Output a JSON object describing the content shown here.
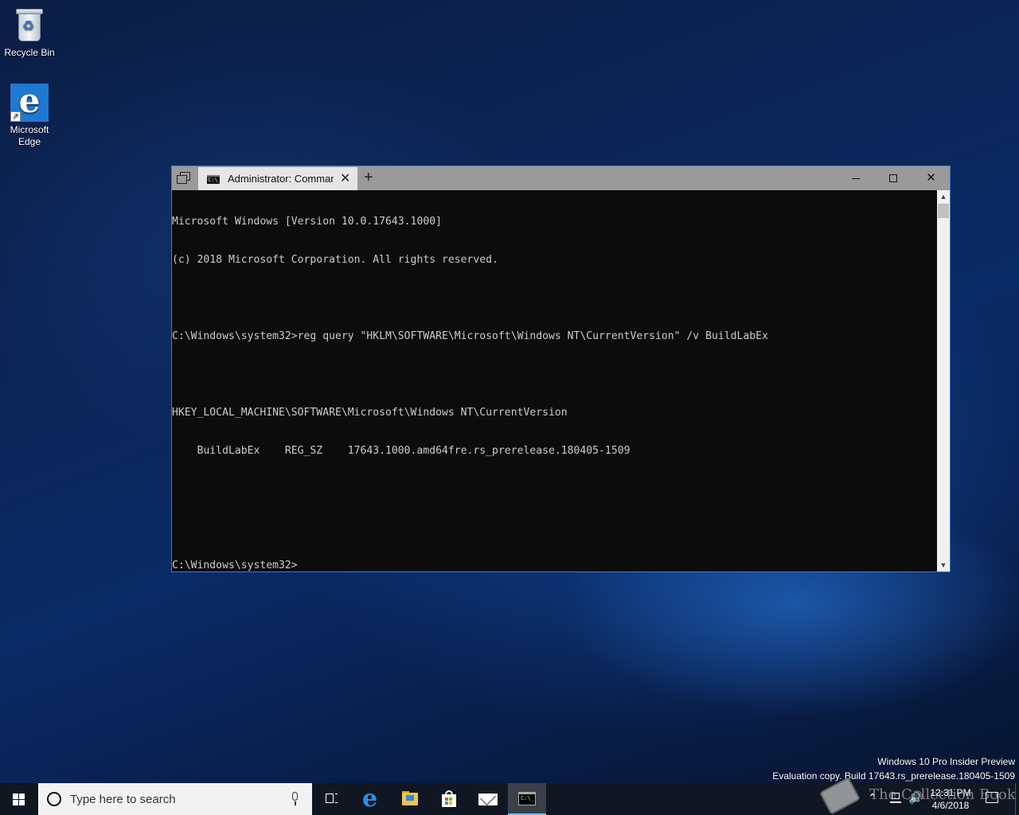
{
  "desktop": {
    "icons": [
      {
        "label": "Recycle Bin",
        "icon": "recycle-bin-icon"
      },
      {
        "label": "Microsoft Edge",
        "icon": "edge-icon"
      }
    ]
  },
  "window": {
    "tab_title": "Administrator: Command Prompt",
    "active_border_color": "#3f7fc4",
    "titlebar_color": "#9a9a9a",
    "console_bg": "#0c0c0c",
    "console_fg": "#cccccc",
    "console_lines": [
      "Microsoft Windows [Version 10.0.17643.1000]",
      "(c) 2018 Microsoft Corporation. All rights reserved.",
      "",
      "C:\\Windows\\system32>reg query \"HKLM\\SOFTWARE\\Microsoft\\Windows NT\\CurrentVersion\" /v BuildLabEx",
      "",
      "HKEY_LOCAL_MACHINE\\SOFTWARE\\Microsoft\\Windows NT\\CurrentVersion",
      "    BuildLabEx    REG_SZ    17643.1000.amd64fre.rs_prerelease.180405-1509",
      "",
      "",
      "C:\\Windows\\system32>"
    ]
  },
  "watermark": {
    "line1": "Windows 10 Pro Insider Preview",
    "line2": "Evaluation copy. Build 17643.rs_prerelease.180405-1509"
  },
  "taskbar": {
    "search_placeholder": "Type here to search",
    "apps": [
      "task-view-icon",
      "edge-icon",
      "file-explorer-icon",
      "store-icon",
      "mail-icon",
      "command-prompt-icon"
    ],
    "active_app": "command-prompt-icon",
    "clock_time": "12:31 PM",
    "clock_date": "4/6/2018"
  },
  "overlay_logo": {
    "text": "The Collection Book"
  }
}
